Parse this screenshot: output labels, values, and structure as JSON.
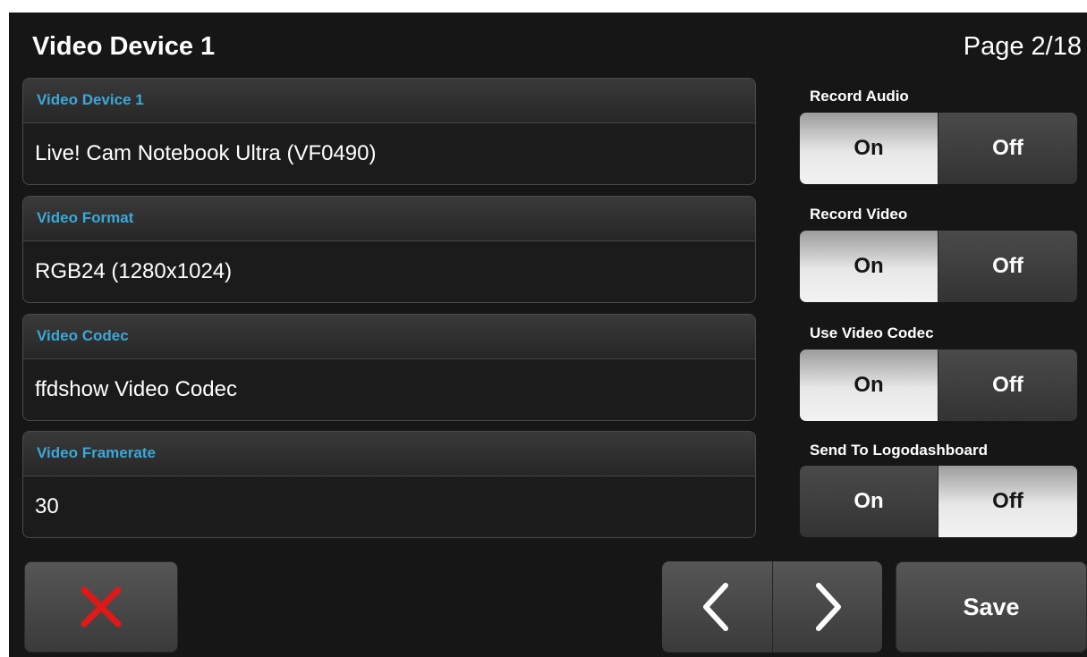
{
  "header": {
    "title": "Video Device 1",
    "page_indicator": "Page 2/18"
  },
  "fields": [
    {
      "label": "Video Device 1",
      "value": "Live! Cam Notebook Ultra (VF0490)"
    },
    {
      "label": "Video Format",
      "value": "RGB24 (1280x1024)"
    },
    {
      "label": "Video Codec",
      "value": "ffdshow Video Codec"
    },
    {
      "label": "Video Framerate",
      "value": "30"
    }
  ],
  "toggles": [
    {
      "label": "Record Audio",
      "on_label": "On",
      "off_label": "Off",
      "selected": "On"
    },
    {
      "label": "Record Video",
      "on_label": "On",
      "off_label": "Off",
      "selected": "On"
    },
    {
      "label": "Use Video Codec",
      "on_label": "On",
      "off_label": "Off",
      "selected": "On"
    },
    {
      "label": "Send To Logodashboard",
      "on_label": "On",
      "off_label": "Off",
      "selected": "Off"
    }
  ],
  "footer": {
    "cancel_icon": "close-icon",
    "prev_icon": "chevron-left-icon",
    "next_icon": "chevron-right-icon",
    "save_label": "Save"
  },
  "colors": {
    "accent": "#3ba8d8",
    "cancel": "#e01818",
    "background": "#161616"
  }
}
